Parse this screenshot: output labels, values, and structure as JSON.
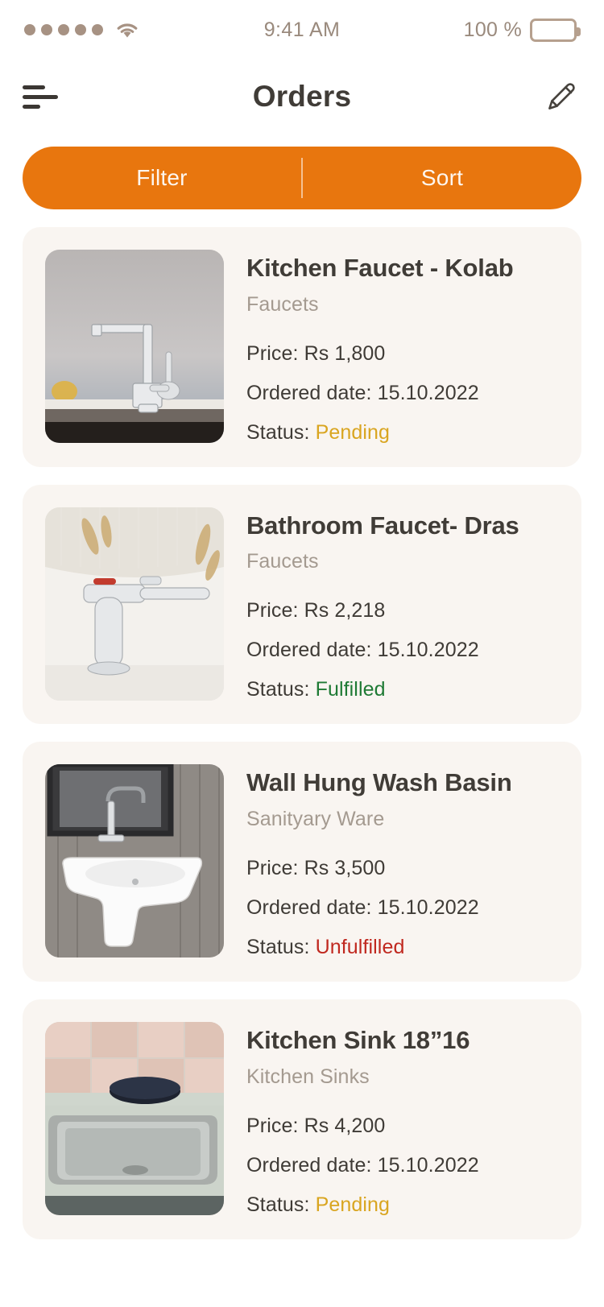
{
  "status_bar": {
    "signal_dots": 5,
    "signal_icon": "signal-dots-icon",
    "wifi_icon": "wifi-icon",
    "time": "9:41 AM",
    "battery_text": "100 %",
    "battery_icon": "battery-full-icon",
    "tint_color": "#a79283"
  },
  "nav": {
    "menu_icon": "hamburger-menu-icon",
    "title": "Orders",
    "edit_icon": "pencil-edit-icon"
  },
  "toolbar": {
    "filter_label": "Filter",
    "sort_label": "Sort",
    "accent_color": "#e8760e"
  },
  "status_colors": {
    "Pending": "#d9a520",
    "Fulfilled": "#1f7a35",
    "Unfulfilled": "#c0281f"
  },
  "labels": {
    "price_prefix": "Price: ",
    "date_prefix": "Ordered date: ",
    "status_prefix": "Status: "
  },
  "orders": [
    {
      "title": "Kitchen Faucet - Kolab",
      "category": "Faucets",
      "price": "Rs 1,800",
      "ordered_date": "15.10.2022",
      "status": "Pending",
      "image_alt": "kitchen-faucet-photo"
    },
    {
      "title": "Bathroom Faucet- Dras",
      "category": "Faucets",
      "price": "Rs 2,218",
      "ordered_date": "15.10.2022",
      "status": "Fulfilled",
      "image_alt": "bathroom-faucet-photo"
    },
    {
      "title": "Wall Hung Wash Basin",
      "category": "Sanityary Ware",
      "price": "Rs 3,500",
      "ordered_date": "15.10.2022",
      "status": "Unfulfilled",
      "image_alt": "wall-hung-wash-basin-photo"
    },
    {
      "title": "Kitchen Sink 18”16",
      "category": "Kitchen Sinks",
      "price": "Rs 4,200",
      "ordered_date": "15.10.2022",
      "status": "Pending",
      "image_alt": "kitchen-sink-photo"
    }
  ]
}
